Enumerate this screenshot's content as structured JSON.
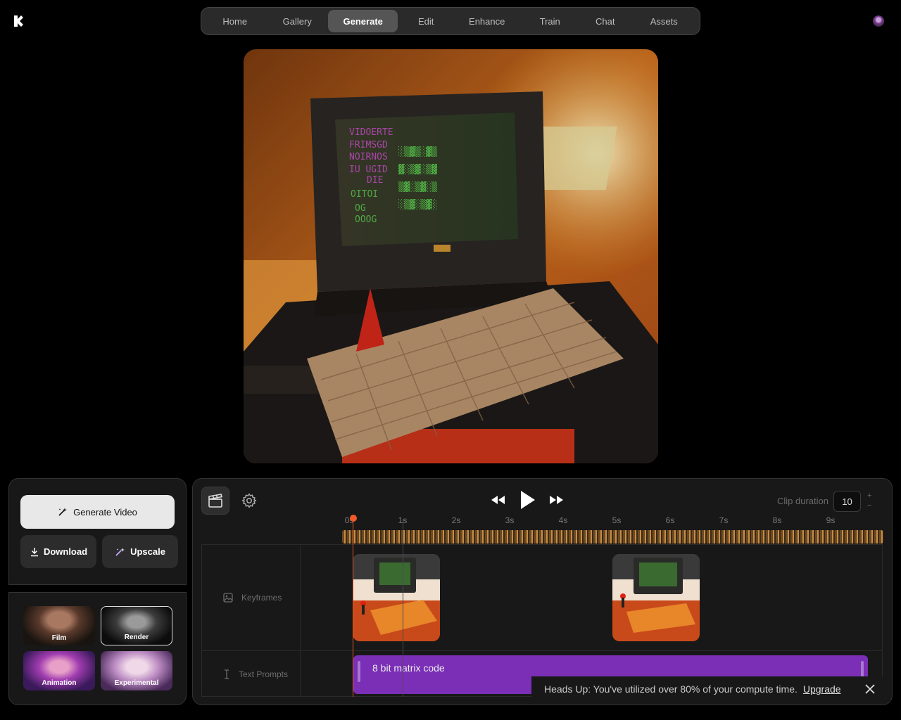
{
  "nav": {
    "tabs": [
      {
        "label": "Home",
        "width": 90
      },
      {
        "label": "Gallery",
        "width": 88
      },
      {
        "label": "Generate",
        "width": 100,
        "active": true
      },
      {
        "label": "Edit",
        "width": 80
      },
      {
        "label": "Enhance",
        "width": 94
      },
      {
        "label": "Train",
        "width": 86
      },
      {
        "label": "Chat",
        "width": 72
      },
      {
        "label": "Assets",
        "width": 96
      }
    ]
  },
  "actions": {
    "generate_video": "Generate Video",
    "download": "Download",
    "upscale": "Upscale"
  },
  "styles": [
    {
      "label": "Film"
    },
    {
      "label": "Render",
      "selected": true
    },
    {
      "label": "Animation"
    },
    {
      "label": "Experimental"
    }
  ],
  "timeline": {
    "clip_duration_label": "Clip duration",
    "clip_duration_value": "10",
    "ticks": [
      "0s",
      "1s",
      "2s",
      "3s",
      "4s",
      "5s",
      "6s",
      "7s",
      "8s",
      "9s"
    ],
    "rows": {
      "keyframes": "Keyframes",
      "text_prompts": "Text Prompts"
    },
    "prompt": "8 bit matrix code"
  },
  "toast": {
    "message": "Heads Up: You've utilized over 80% of your compute time.",
    "link": "Upgrade"
  },
  "colors": {
    "accent_purple": "#7a2fb6",
    "playhead": "#f05a28",
    "background": "#000000",
    "panel": "#181818"
  }
}
